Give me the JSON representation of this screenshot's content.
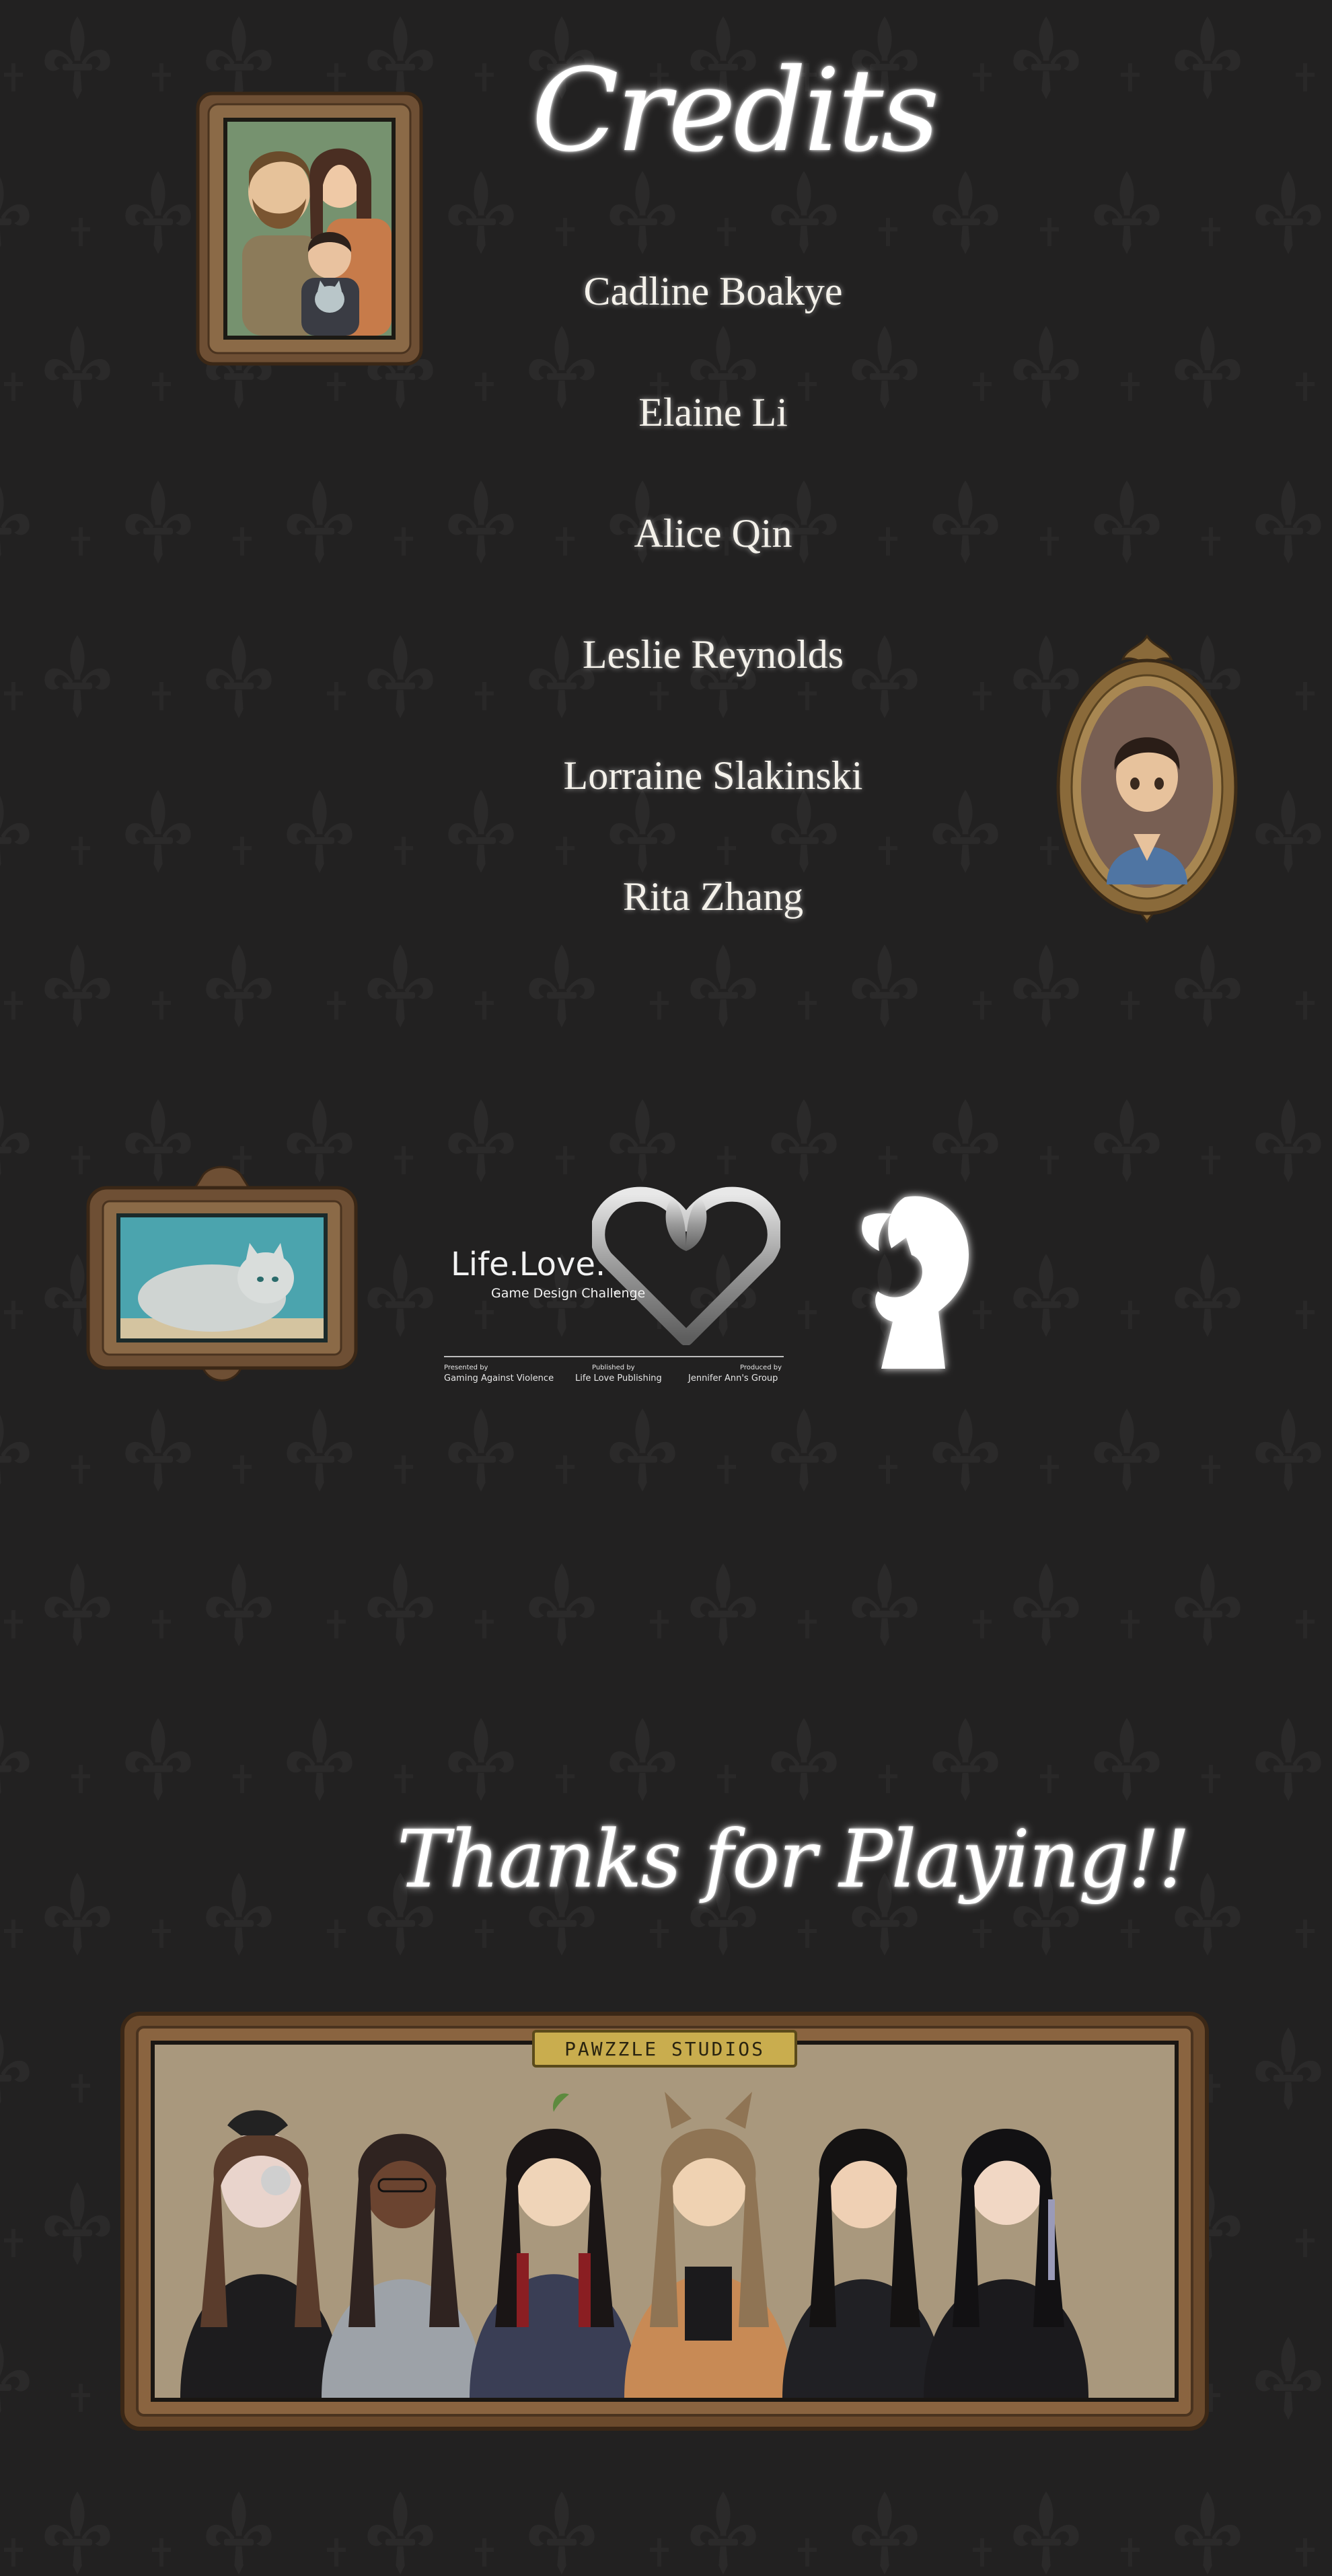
{
  "screen": {
    "title": "Credits",
    "team": [
      "Cadline Boakye",
      "Elaine Li",
      "Alice Qin",
      "Leslie Reynolds",
      "Lorraine Slakinski",
      "Rita Zhang"
    ],
    "closing_message": "Thanks for Playing!!"
  },
  "partner_logo": {
    "name": "Life.Love.",
    "subtitle": "Game Design Challenge",
    "tm": "™",
    "footer": [
      {
        "role": "Presented by",
        "org": "Gaming Against Violence"
      },
      {
        "role": "Published by",
        "org": "Life Love Publishing"
      },
      {
        "role": "Produced by",
        "org": "Jennifer Ann's Group"
      }
    ]
  },
  "team_portrait": {
    "plaque": "PAWZZLE STUDIOS"
  },
  "colors": {
    "background": "#222121",
    "wallpaper_motif": "#2b2a2a",
    "text": "#f4f1ea",
    "frame_wood": "#7a5a3a",
    "frame_gold": "#8a6a3a"
  },
  "icons": [
    "fleur-de-lis-icon",
    "life-love-heart-emblem-icon",
    "cat-keyhole-logo-icon"
  ]
}
